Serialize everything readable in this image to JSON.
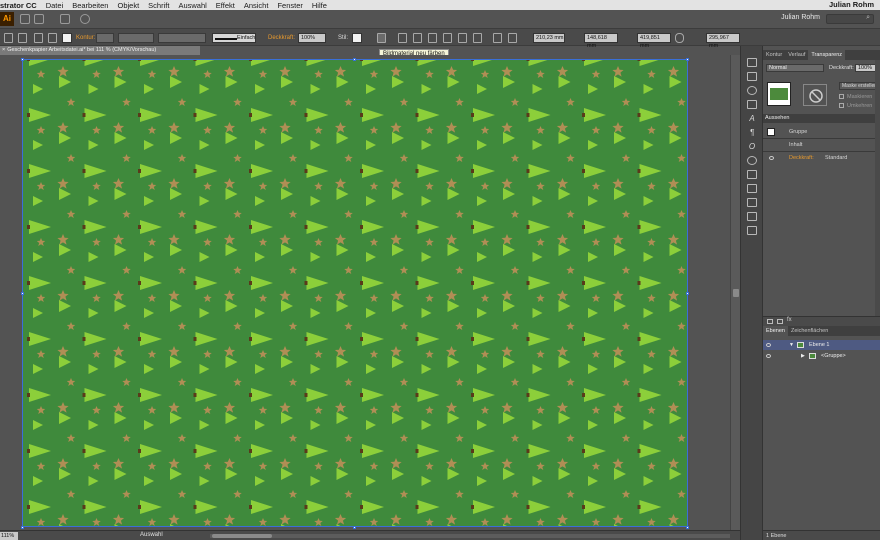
{
  "menubar": {
    "app_name": "strator CC",
    "items": [
      "Datei",
      "Bearbeiten",
      "Objekt",
      "Schrift",
      "Auswahl",
      "Effekt",
      "Ansicht",
      "Fenster",
      "Hilfe"
    ],
    "right_user": "Julian Rohm"
  },
  "appbar": {
    "logo": "Ai",
    "user": "Julian Rohm",
    "search_icon": "search-icon"
  },
  "controlbar": {
    "kontur_label": "Kontur:",
    "stroke_style": "Einfach",
    "deckkraft_label": "Deckkraft:",
    "deckkraft_value": "100%",
    "stil_label": "Stil:",
    "x_value": "210,23 mm",
    "y_value": "148,618 mm",
    "w_value": "419,851 mm",
    "h_value": "295,967 mm"
  },
  "tooltip": {
    "text": "Bildmaterial neu färben"
  },
  "document": {
    "tab_title": "Geschenkpapier Arbeitsdatei.ai* bei 111 % (CMYK/Vorschau)",
    "close_glyph": "×"
  },
  "artboard": {
    "background_color": "#3f8a3c",
    "tree_color": "#8ccf3a",
    "star_color": "#b08e55"
  },
  "statusbar": {
    "zoom": "111%",
    "tool": "Auswahl"
  },
  "panel": {
    "tabs": [
      "Kontur",
      "Verlauf",
      "Transparenz"
    ],
    "active_tab": "Transparenz",
    "blend_mode": "Normal",
    "opacity_label": "Deckkraft:",
    "opacity_value": "100%",
    "mask_button": "Maske erstellen",
    "clip_label": "Maskieren",
    "invert_label": "Umkehren",
    "appearance_title": "Aussehen",
    "appearance_rows": [
      {
        "label": "Gruppe",
        "value": ""
      },
      {
        "label": "Inhalt",
        "value": ""
      },
      {
        "label": "Deckkraft:",
        "value": "Standard"
      }
    ],
    "layers_tabs": [
      "Ebenen",
      "Zeichenflächen"
    ],
    "layers": [
      {
        "name": "Ebene 1"
      },
      {
        "name": "<Gruppe>"
      }
    ],
    "layers_footer": "1 Ebene"
  }
}
